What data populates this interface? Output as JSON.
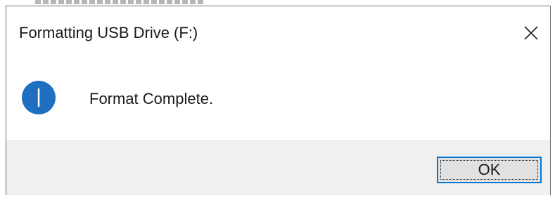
{
  "dialog": {
    "title": "Formatting USB Drive (F:)",
    "message": "Format Complete.",
    "ok_label": "OK"
  },
  "icons": {
    "close": "close-icon",
    "info": "info-icon"
  },
  "colors": {
    "info_icon_fill": "#1e6fbf",
    "focus_border": "#0078d7",
    "footer_background": "#f0f0f0",
    "button_background": "#e1e1e1"
  }
}
